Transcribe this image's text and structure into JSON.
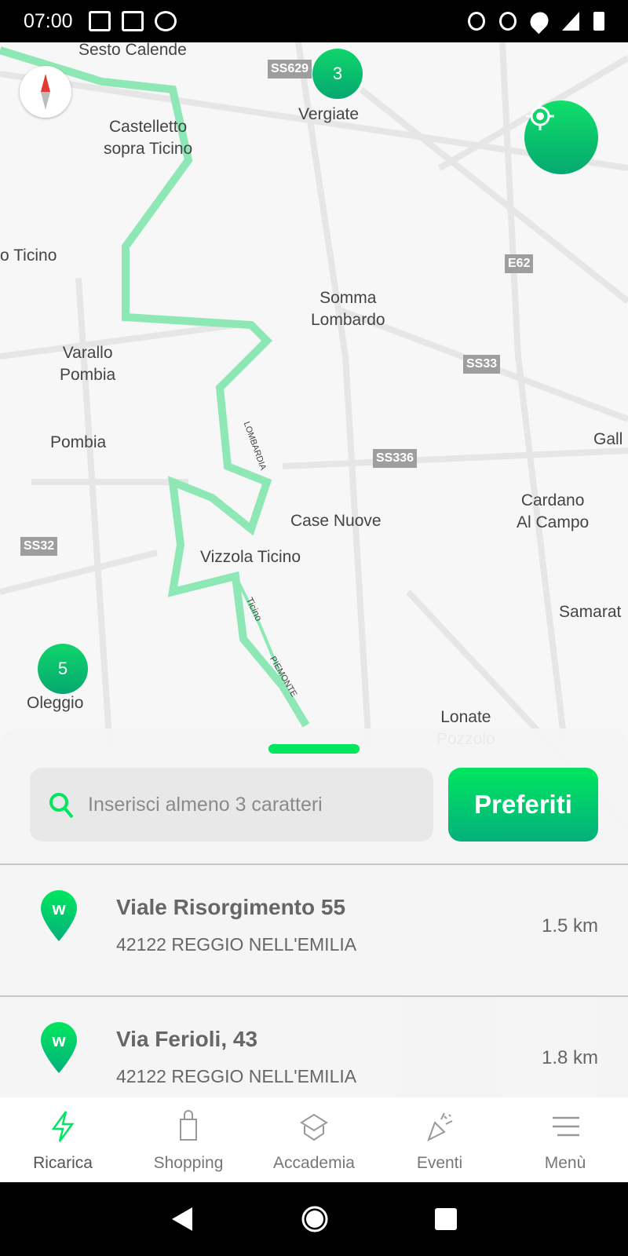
{
  "status_bar": {
    "time": "07:00"
  },
  "map": {
    "labels": [
      "Sesto Calende",
      "Castelletto\nsopra Ticino",
      "Vergiate",
      "o Ticino",
      "Somma\nLombardo",
      "Varallo\nPombia",
      "Pombia",
      "Case Nuove",
      "Cardano\nAl Campo",
      "Vizzola Ticino",
      "Samarat",
      "Oleggio",
      "Gall",
      "Lonate\nPozzolo"
    ],
    "road_shields": [
      "SS629",
      "E62",
      "SS33",
      "SS336",
      "SS32"
    ],
    "clusters": [
      "3",
      "5"
    ],
    "river_labels": [
      "LOMBARDIA",
      "Ticino",
      "PIEMONTE"
    ]
  },
  "sheet": {
    "search_placeholder": "Inserisci almeno 3 caratteri",
    "favorites_label": "Preferiti",
    "results": [
      {
        "title": "Viale Risorgimento 55",
        "subtitle": "42122 REGGIO NELL'EMILIA",
        "distance": "1.5 km"
      },
      {
        "title": "Via Ferioli, 43",
        "subtitle": "42122 REGGIO NELL'EMILIA",
        "distance": "1.8 km"
      }
    ]
  },
  "bottom_nav": [
    {
      "label": "Ricarica",
      "icon": "lightning-icon",
      "active": true
    },
    {
      "label": "Shopping",
      "icon": "shopping-bag-icon"
    },
    {
      "label": "Accademia",
      "icon": "graduation-cap-icon"
    },
    {
      "label": "Eventi",
      "icon": "party-popper-icon"
    },
    {
      "label": "Menù",
      "icon": "hamburger-menu-icon"
    }
  ],
  "colors": {
    "accent": "#00e65e",
    "accent_dark": "#04b07d",
    "river": "#8ee8b5"
  }
}
